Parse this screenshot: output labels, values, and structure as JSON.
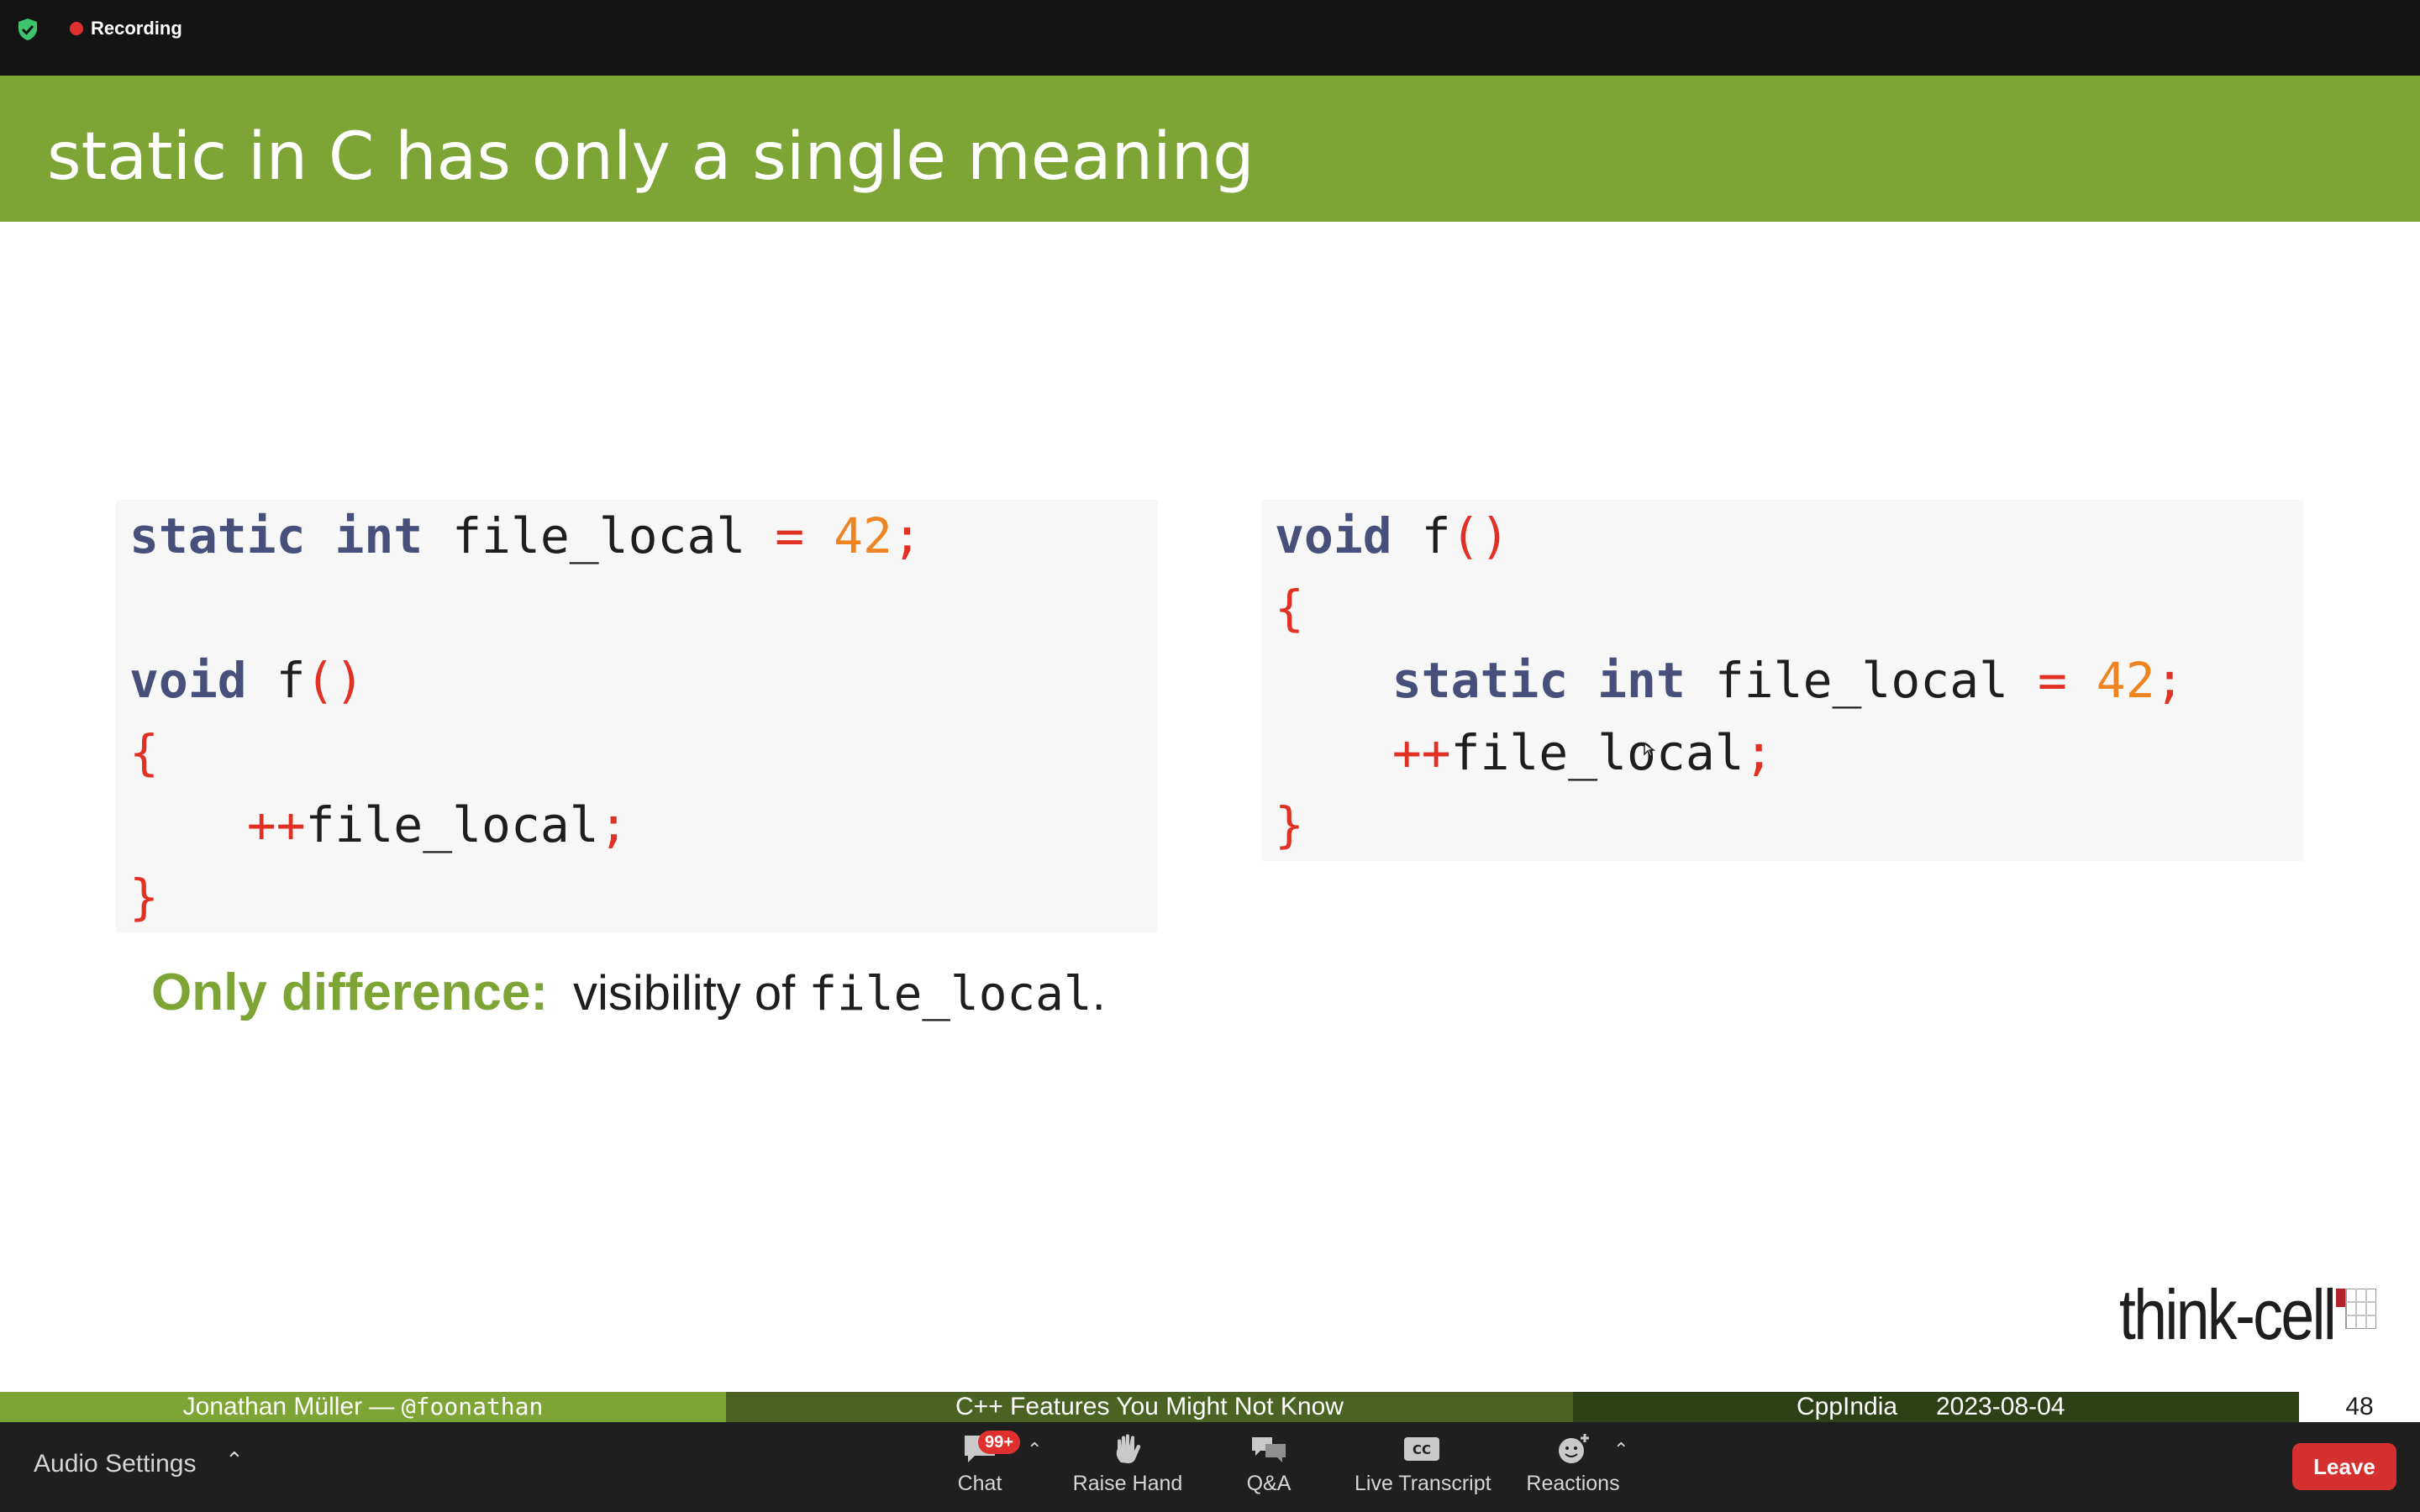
{
  "top_bar": {
    "recording_label": "Recording",
    "colors": {
      "background": "#131313",
      "recording_dot": "#e02f2f",
      "shield": "#3ec46d"
    },
    "icons": [
      "shield-check-icon",
      "recording-dot-icon"
    ]
  },
  "slide": {
    "title": "static in C has only a single meaning",
    "colors": {
      "header": "#7ca535",
      "keyword": "#46507a",
      "number": "#ef8422",
      "punctuation": "#e03124",
      "code_bg": "#f7f7f8"
    },
    "left_code": {
      "l1": {
        "kw1": "static",
        "kw2": "int",
        "id": "file_local",
        "op": "=",
        "num": "42",
        "semi": ";"
      },
      "l2": {
        "kw": "void",
        "id": "f",
        "parens": "()"
      },
      "l3": {
        "brace": "{"
      },
      "l4": {
        "op": "++",
        "id": "file_local",
        "semi": ";"
      },
      "l5": {
        "brace": "}"
      }
    },
    "right_code": {
      "l1": {
        "kw": "void",
        "id": "f",
        "parens": "()"
      },
      "l2": {
        "brace": "{"
      },
      "l3": {
        "kw1": "static",
        "kw2": "int",
        "id": "file_local",
        "op": "=",
        "num": "42",
        "semi": ";"
      },
      "l4": {
        "op": "++",
        "id": "file_local",
        "semi": ";"
      },
      "l5": {
        "brace": "}"
      }
    },
    "note": {
      "strong": "Only difference:",
      "text": "visibility of",
      "code": "file_local",
      "end": "."
    },
    "logo_text": "think-cell",
    "footer": {
      "author_name": "Jonathan Müller —",
      "author_handle": "@foonathan",
      "talk_title": "C++ Features You Might Not Know",
      "event": "CppIndia",
      "date": "2023-08-04",
      "page": "48"
    }
  },
  "bottom_bar": {
    "audio_settings": "Audio Settings",
    "controls": [
      {
        "label": "Chat",
        "icon": "chat-bubble-icon",
        "badge": "99+"
      },
      {
        "label": "Raise Hand",
        "icon": "raise-hand-icon"
      },
      {
        "label": "Q&A",
        "icon": "qa-bubbles-icon"
      },
      {
        "label": "Live Transcript",
        "icon": "cc-icon"
      },
      {
        "label": "Reactions",
        "icon": "smiley-plus-icon"
      }
    ],
    "leave": "Leave",
    "colors": {
      "background": "#1f1f1f",
      "leave": "#d3302f",
      "badge": "#e02f2f"
    }
  }
}
